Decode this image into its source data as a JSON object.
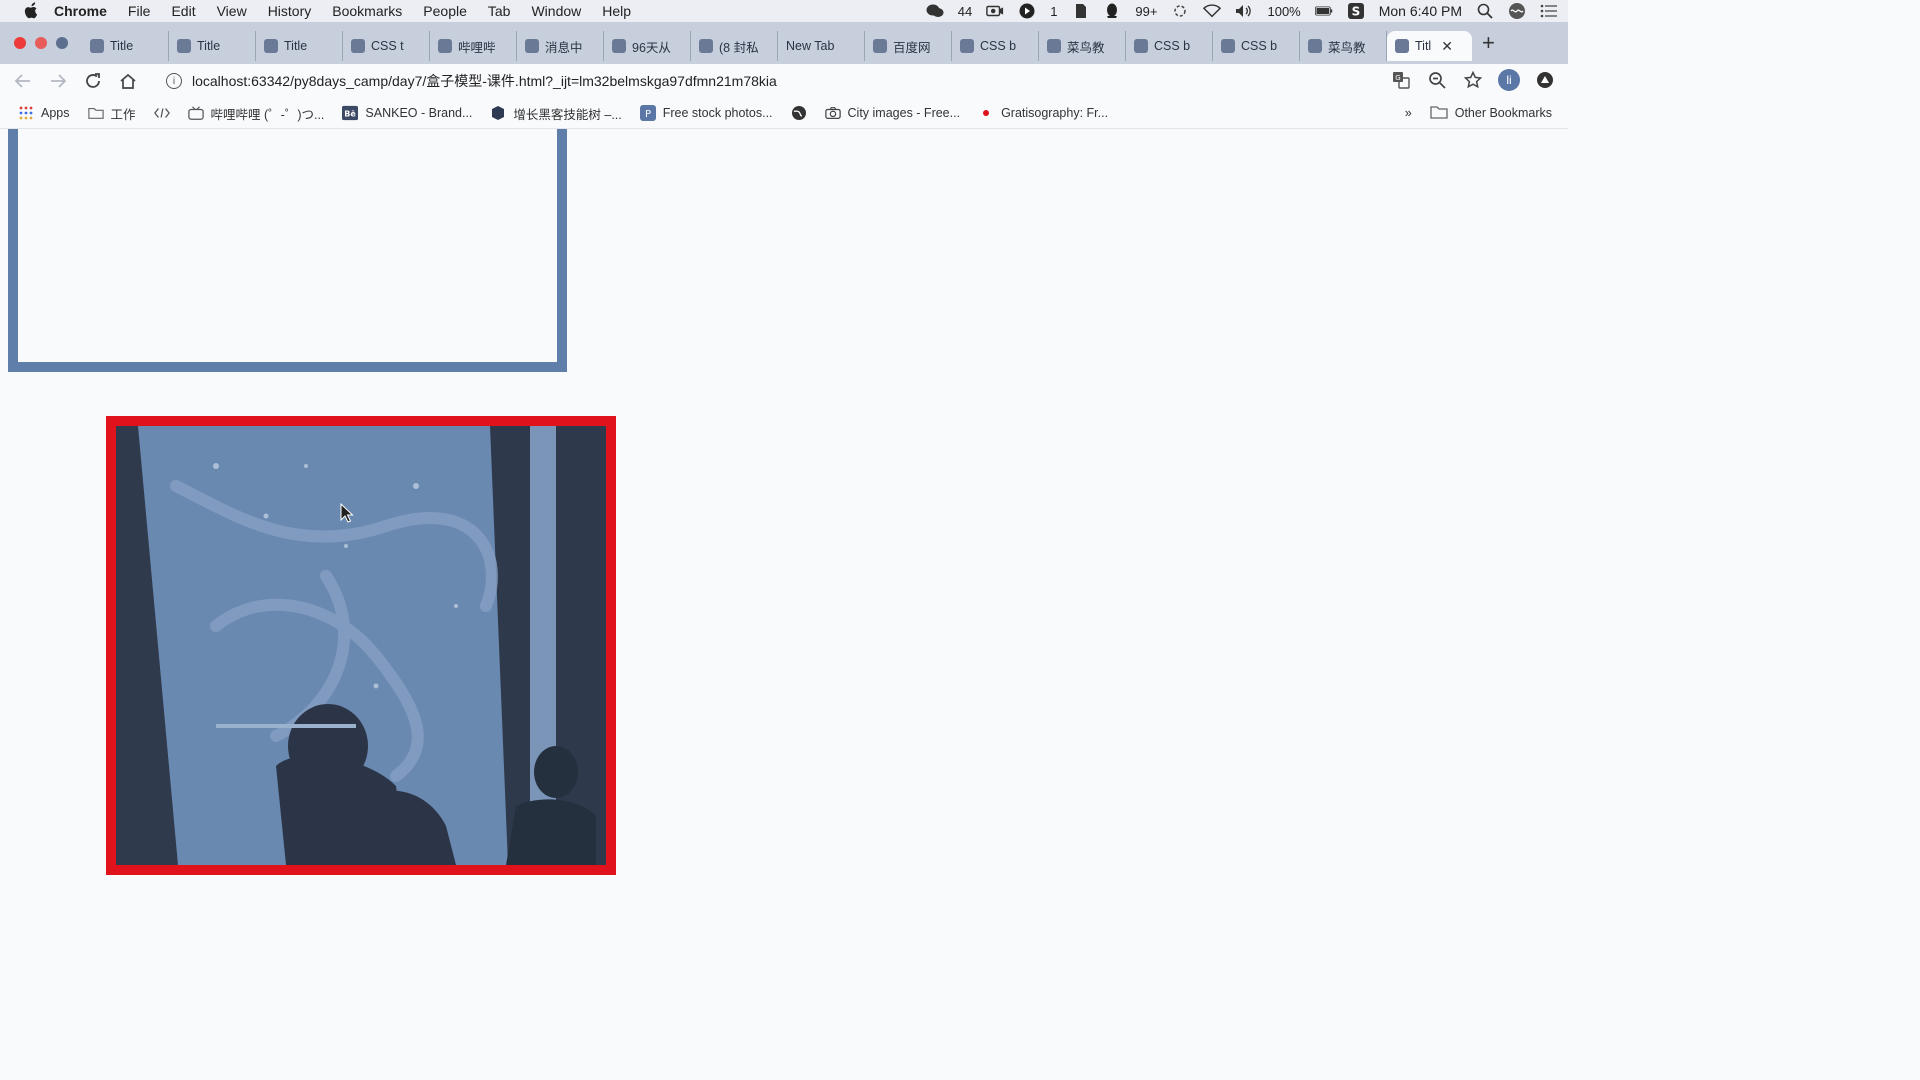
{
  "menubar": {
    "app_name": "Chrome",
    "items": [
      "File",
      "Edit",
      "View",
      "History",
      "Bookmarks",
      "People",
      "Tab",
      "Window",
      "Help"
    ],
    "status": {
      "wechat_count": "44",
      "badge_one": "1",
      "qq_count": "99+",
      "battery": "100%",
      "clock": "Mon 6:40 PM"
    }
  },
  "tabs": [
    {
      "label": "Title"
    },
    {
      "label": "Title"
    },
    {
      "label": "Title"
    },
    {
      "label": "CSS t"
    },
    {
      "label": "哔哩哔"
    },
    {
      "label": "消息中"
    },
    {
      "label": "96天从"
    },
    {
      "label": "(8 封私"
    },
    {
      "label": "New Tab"
    },
    {
      "label": "百度网"
    },
    {
      "label": "CSS b"
    },
    {
      "label": "菜鸟教"
    },
    {
      "label": "CSS b"
    },
    {
      "label": "CSS b"
    },
    {
      "label": "菜鸟教"
    },
    {
      "label": "Titl",
      "active": true
    }
  ],
  "toolbar": {
    "url": "localhost:63342/py8days_camp/day7/盒子模型-课件.html?_ijt=lm32belmskga97dfmn21m78kia",
    "profile_initial": "li"
  },
  "bookmarks": {
    "items": [
      {
        "label": "Apps",
        "icon": "apps-grid-icon"
      },
      {
        "label": "工作",
        "icon": "folder-icon"
      },
      {
        "label": "",
        "icon": "code-icon"
      },
      {
        "label": "哔哩哔哩 (゜-゜)つ...",
        "icon": "bilibili-icon"
      },
      {
        "label": "SANKEO - Brand...",
        "icon": "behance-icon"
      },
      {
        "label": "增长黑客技能树 –...",
        "icon": "cube-icon"
      },
      {
        "label": "Free stock photos...",
        "icon": "pexels-icon"
      },
      {
        "label": "",
        "icon": "globe-icon"
      },
      {
        "label": "City images - Free...",
        "icon": "camera-icon"
      },
      {
        "label": "Gratisography: Fr...",
        "icon": "red-dot-icon"
      }
    ],
    "overflow": "»",
    "other": "Other Bookmarks"
  },
  "colors": {
    "box1_border": "#5f7ea9",
    "box2_border": "#e0121b",
    "tabstrip_bg": "#c7cfdd",
    "page_bg": "#f9fafc"
  }
}
